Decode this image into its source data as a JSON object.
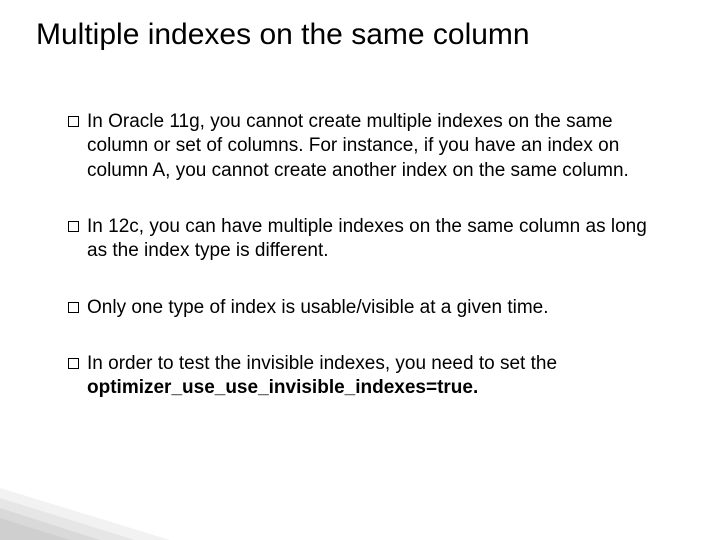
{
  "title": "Multiple indexes on the same column",
  "bullets": {
    "b1": "In Oracle 11g, you cannot create multiple indexes on the same column or set of columns. For instance, if you have an index on column A, you cannot create another index on the same column.",
    "b2": " In 12c, you can have multiple indexes on the same column as long as the index type is different.",
    "b3": "Only one type of index is usable/visible at a given time.",
    "b4_pre": "In order to test the invisible indexes, you need to set the ",
    "b4_bold": "optimizer_use_use_invisible_indexes=true.",
    "b4_post": ""
  }
}
